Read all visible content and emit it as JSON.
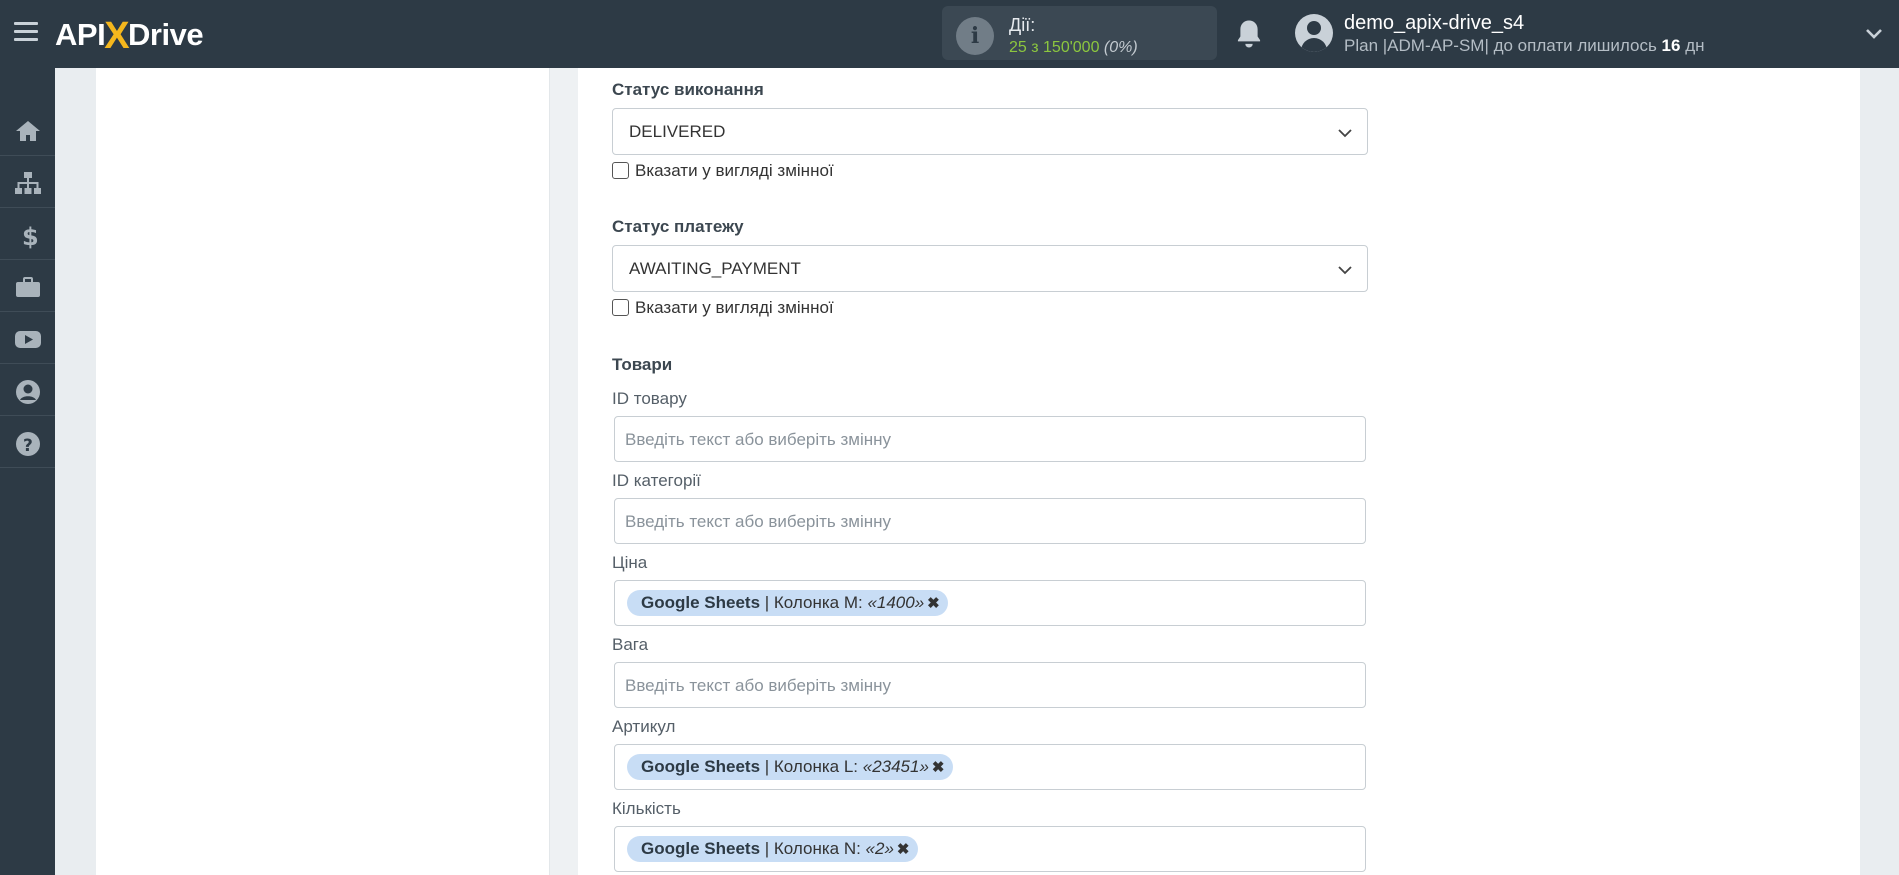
{
  "header": {
    "logo_left": "API",
    "logo_x": "X",
    "logo_right": "Drive",
    "actions_label": "Дії:",
    "actions_used": "25 з 150'000",
    "actions_pct": "(0%)",
    "username": "demo_apix-drive_s4",
    "plan_prefix": "Plan |ADM-AP-SM| до оплати лишилось ",
    "plan_days": "16",
    "plan_suffix": " дн",
    "icons": [
      "menu-icon",
      "info-icon",
      "bell-icon",
      "user-avatar-icon",
      "chevron-down-icon"
    ]
  },
  "sidebar": {
    "items": [
      {
        "icon": "home-icon"
      },
      {
        "icon": "sitemap-icon"
      },
      {
        "icon": "dollar-icon"
      },
      {
        "icon": "briefcase-icon"
      },
      {
        "icon": "youtube-icon"
      },
      {
        "icon": "user-circle-icon"
      },
      {
        "icon": "question-circle-icon"
      }
    ]
  },
  "form": {
    "status_title": "Статус виконання",
    "status_value": "DELIVERED",
    "status_checkbox": "Вказати у вигляді змінної",
    "payment_title": "Статус платежу",
    "payment_value": "AWAITING_PAYMENT",
    "payment_checkbox": "Вказати у вигляді змінної",
    "goods_title": "Товари",
    "placeholder": "Введіть текст або виберіть змінну",
    "product_id_label": "ID товару",
    "category_id_label": "ID категорії",
    "price_label": "Ціна",
    "price_tag": {
      "source": "Google Sheets",
      "column": " | Колонка M: ",
      "value": "«1400»"
    },
    "weight_label": "Вага",
    "sku_label": "Артикул",
    "sku_tag": {
      "source": "Google Sheets",
      "column": " | Колонка L: ",
      "value": "«23451»"
    },
    "qty_label": "Кількість",
    "qty_tag": {
      "source": "Google Sheets",
      "column": " | Колонка N: ",
      "value": "«2»"
    },
    "tag_remove": "✖"
  }
}
